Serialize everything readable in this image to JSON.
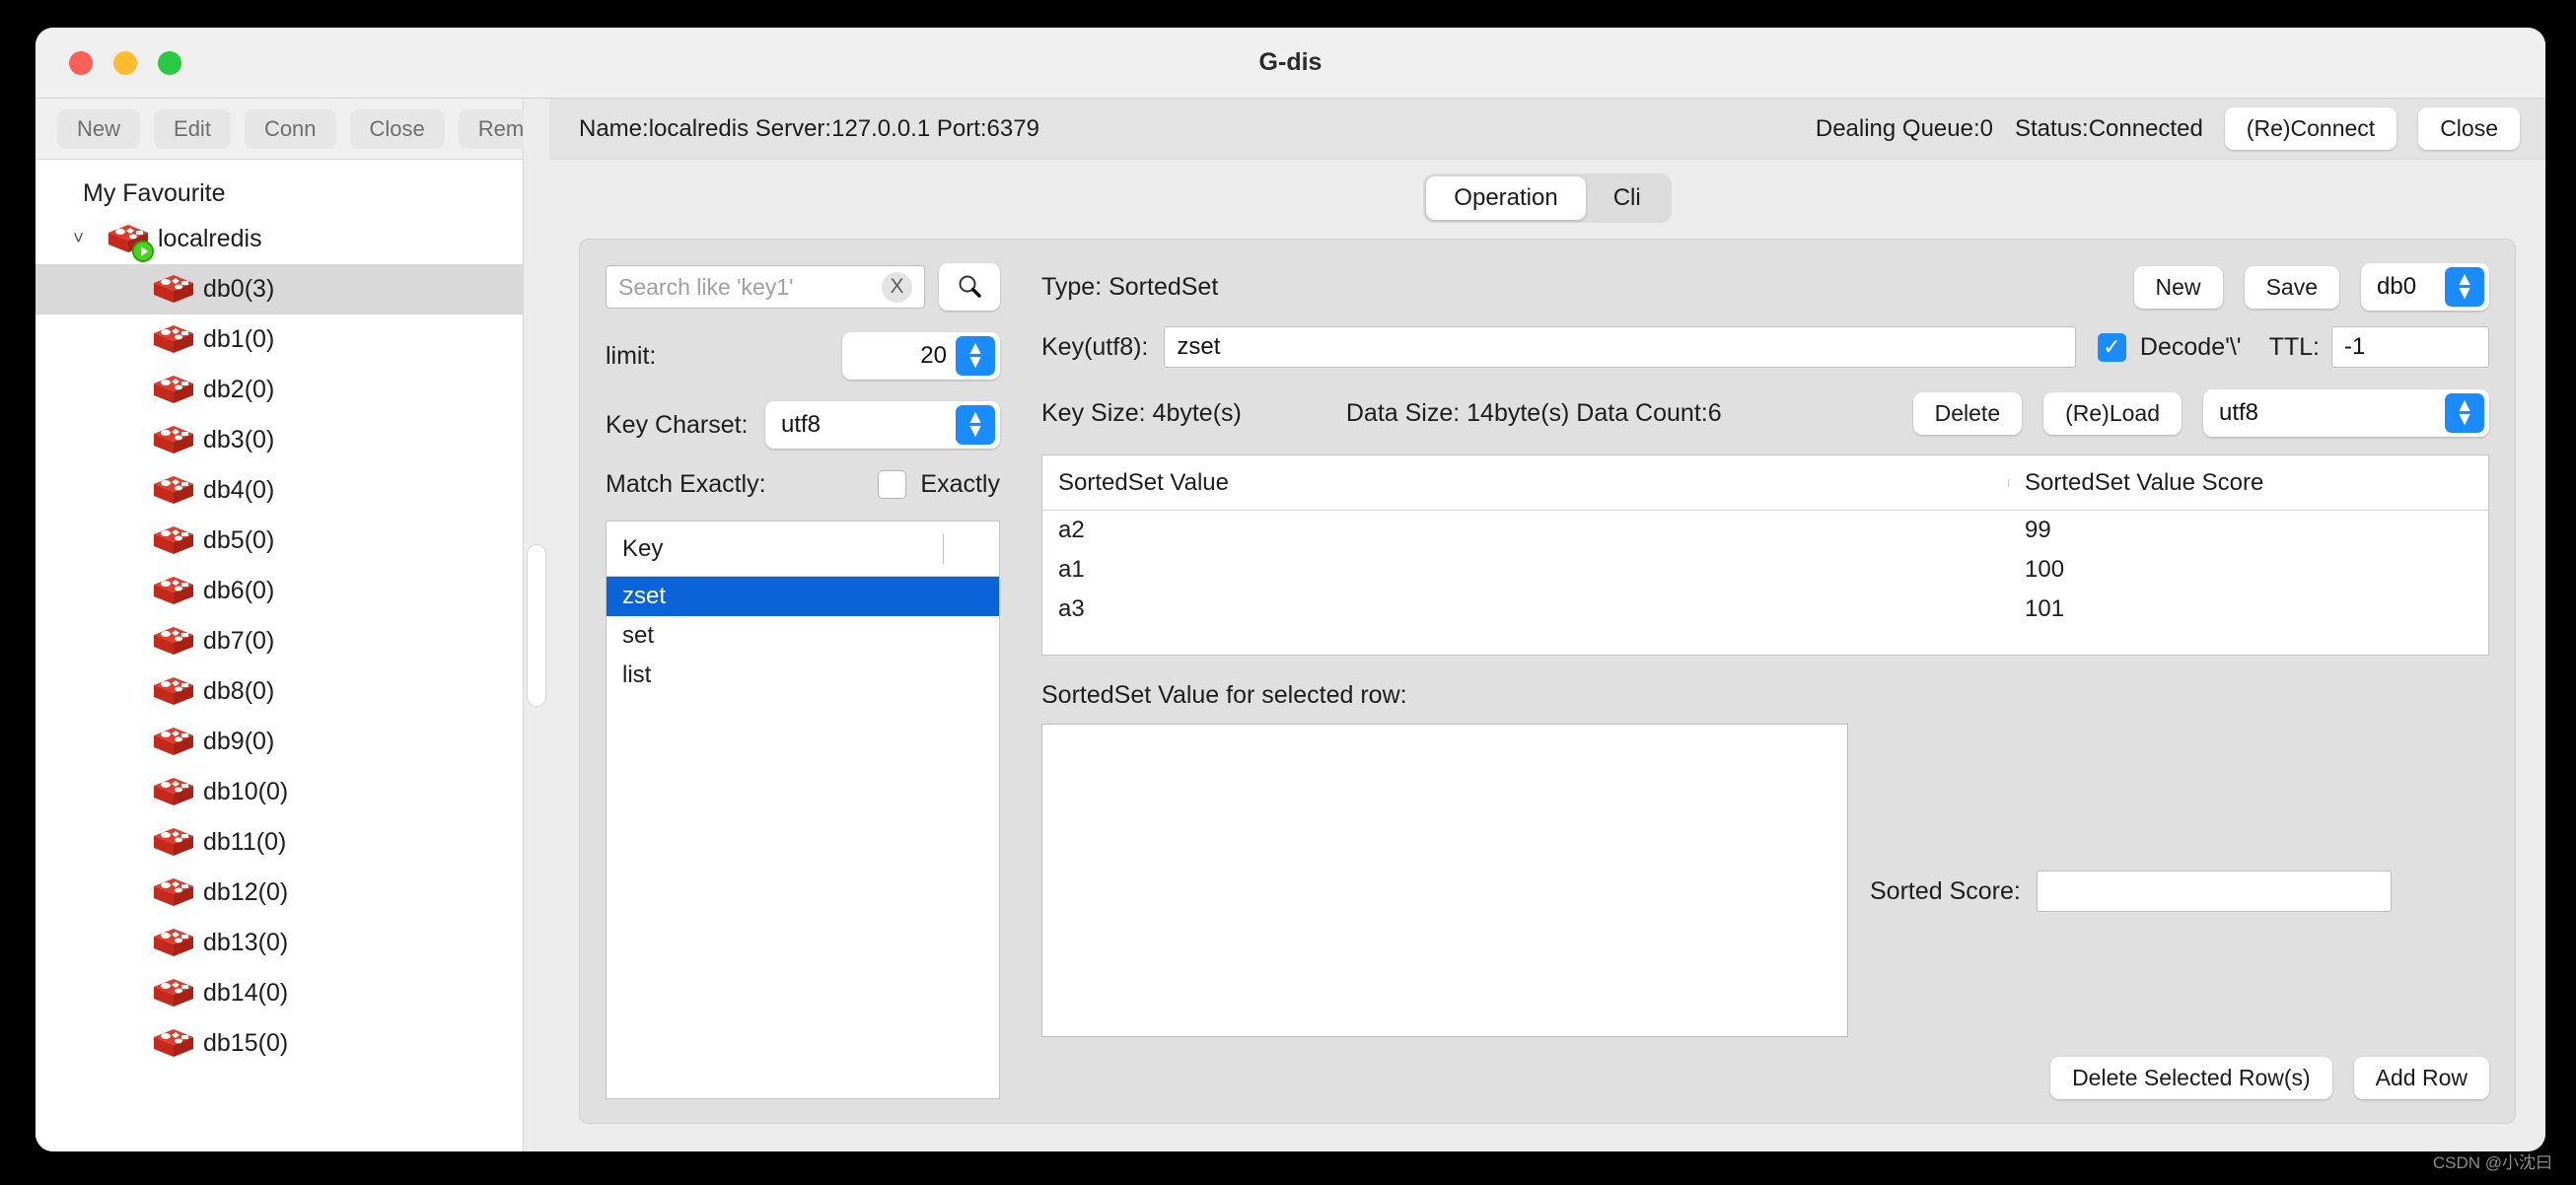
{
  "window": {
    "title": "G-dis"
  },
  "toolbar": {
    "buttons": [
      "New",
      "Edit",
      "Conn",
      "Close",
      "Rem"
    ]
  },
  "sidebar": {
    "root_label": "My Favourite",
    "connection": {
      "label": "localredis",
      "icon": "redis-cube-icon",
      "expanded": true
    },
    "databases": [
      {
        "label": "db0(3)",
        "selected": true
      },
      {
        "label": "db1(0)",
        "selected": false
      },
      {
        "label": "db2(0)",
        "selected": false
      },
      {
        "label": "db3(0)",
        "selected": false
      },
      {
        "label": "db4(0)",
        "selected": false
      },
      {
        "label": "db5(0)",
        "selected": false
      },
      {
        "label": "db6(0)",
        "selected": false
      },
      {
        "label": "db7(0)",
        "selected": false
      },
      {
        "label": "db8(0)",
        "selected": false
      },
      {
        "label": "db9(0)",
        "selected": false
      },
      {
        "label": "db10(0)",
        "selected": false
      },
      {
        "label": "db11(0)",
        "selected": false
      },
      {
        "label": "db12(0)",
        "selected": false
      },
      {
        "label": "db13(0)",
        "selected": false
      },
      {
        "label": "db14(0)",
        "selected": false
      },
      {
        "label": "db15(0)",
        "selected": false
      }
    ]
  },
  "connection_header": {
    "info": "Name:localredis Server:127.0.0.1 Port:6379",
    "dealing_queue": "Dealing Queue:0",
    "status": "Status:Connected",
    "reconnect_label": "(Re)Connect",
    "close_label": "Close"
  },
  "tabs": [
    {
      "label": "Operation",
      "active": true
    },
    {
      "label": "Cli",
      "active": false
    }
  ],
  "search": {
    "placeholder": "Search like 'key1'",
    "value": "",
    "clear_label": "X",
    "search_icon": "magnifier-icon"
  },
  "filters": {
    "limit_label": "limit:",
    "limit_value": "20",
    "charset_label": "Key Charset:",
    "charset_value": "utf8",
    "match_label": "Match Exactly:",
    "exactly_label": "Exactly",
    "exactly_checked": false
  },
  "key_list": {
    "header": "Key",
    "rows": [
      {
        "key": "zset",
        "selected": true
      },
      {
        "key": "set",
        "selected": false
      },
      {
        "key": "list",
        "selected": false
      }
    ]
  },
  "detail": {
    "type_label": "Type: SortedSet",
    "key_label": "Key(utf8):",
    "key_value": "zset",
    "decode_label": "Decode'\\'",
    "decode_checked": true,
    "ttl_label": "TTL:",
    "ttl_value": "-1",
    "new_label": "New",
    "save_label": "Save",
    "db_value": "db0",
    "key_size": "Key Size: 4byte(s)",
    "data_size": "Data Size: 14byte(s) Data Count:6",
    "delete_label": "Delete",
    "reload_label": "(Re)Load",
    "value_charset": "utf8"
  },
  "table": {
    "columns": [
      "SortedSet Value",
      "SortedSet Value Score"
    ],
    "rows": [
      {
        "value": "a2",
        "score": "99"
      },
      {
        "value": "a1",
        "score": "100"
      },
      {
        "value": "a3",
        "score": "101"
      }
    ]
  },
  "editor": {
    "value_label": "SortedSet Value for selected row:",
    "value_text": "",
    "score_label": "Sorted Score:",
    "score_value": "",
    "delete_rows_label": "Delete Selected Row(s)",
    "add_row_label": "Add Row"
  },
  "watermark": "CSDN @小沈曰",
  "colors": {
    "accent_blue": "#1a8cff",
    "selection_blue": "#0a64d8",
    "redis_red": "#d62b1f",
    "window_bg": "#ececec"
  }
}
